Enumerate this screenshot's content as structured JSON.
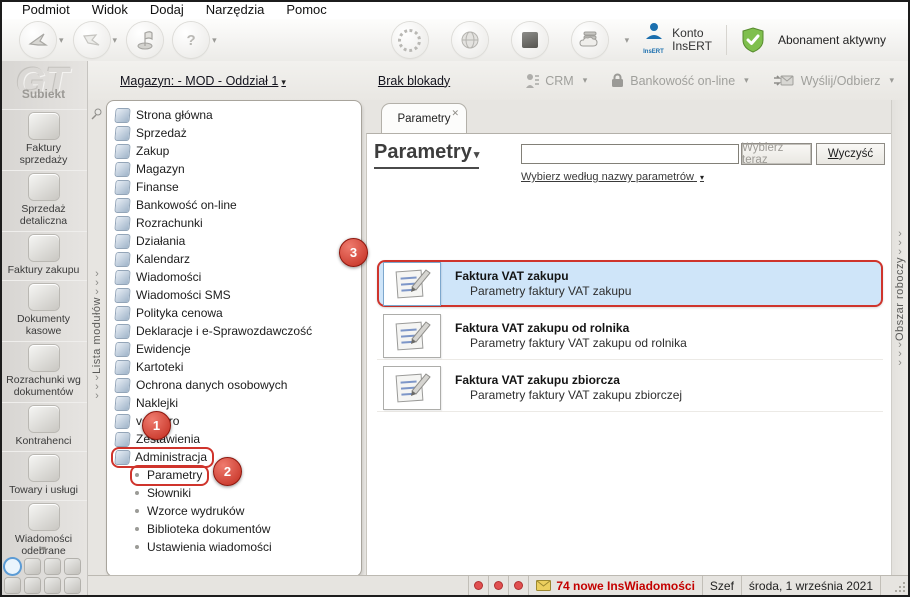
{
  "menu_bar": {
    "items": [
      "Podmiot",
      "Widok",
      "Dodaj",
      "Narzędzia",
      "Pomoc"
    ]
  },
  "toolbar": {
    "account_line1": "Konto",
    "account_line2": "InsERT",
    "account_badge": "InsERT",
    "subscription_label": "Abonament aktywny"
  },
  "context_bar": {
    "warehouse_label": "Magazyn: - MOD - Oddział 1",
    "lock_status": "Brak blokady",
    "crm_label": "CRM",
    "banking_label": "Bankowość on-line",
    "send_receive_label": "Wyślij/Odbierz"
  },
  "sidebar": {
    "logo_text": "GT",
    "app_name": "Subiekt",
    "items": [
      "Faktury sprzedaży",
      "Sprzedaż detaliczna",
      "Faktury zakupu",
      "Dokumenty kasowe",
      "Rozrachunki wg dokumentów",
      "Kontrahenci",
      "Towary i usługi",
      "Wiadomości odebrane"
    ]
  },
  "left_strip": {
    "label": "Lista modułów"
  },
  "right_strip": {
    "label": "Obszar roboczy"
  },
  "tree": {
    "items": [
      "Strona główna",
      "Sprzedaż",
      "Zakup",
      "Magazyn",
      "Finanse",
      "Bankowość on-line",
      "Rozrachunki",
      "Działania",
      "Kalendarz",
      "Wiadomości",
      "Wiadomości SMS",
      "Polityka cenowa",
      "Deklaracje i e-Sprawozdawczość",
      "Ewidencje",
      "Kartoteki",
      "Ochrona danych osobowych",
      "Naklejki",
      "vendero",
      "Zestawienia",
      "Administracja"
    ],
    "children": [
      "Parametry",
      "Słowniki",
      "Wzorce wydruków",
      "Biblioteka dokumentów",
      "Ustawienia wiadomości"
    ]
  },
  "main": {
    "tab_label": "Parametry",
    "heading": "Parametry",
    "search_value": "",
    "select_button": "Wybierz teraz",
    "clear_button": "Wyczyść",
    "filter_link": "Wybierz według nazwy parametrów",
    "list": [
      {
        "title": "Faktura VAT zakupu",
        "subtitle": "Parametry faktury VAT zakupu"
      },
      {
        "title": "Faktura VAT zakupu od rolnika",
        "subtitle": "Parametry faktury VAT zakupu od rolnika"
      },
      {
        "title": "Faktura VAT zakupu zbiorcza",
        "subtitle": "Parametry faktury VAT zakupu zbiorczej"
      }
    ]
  },
  "status_bar": {
    "messages_label": "74 nowe InsWiadomości",
    "user": "Szef",
    "date": "środa, 1 września 2021"
  },
  "annotations": {
    "step1": "1",
    "step2": "2",
    "step3": "3"
  },
  "icons": {
    "chevron_down": "▾",
    "chevron_right": "›",
    "close": "✕",
    "question": "?"
  },
  "colors": {
    "annotation_red": "#cf342c",
    "selection_blue": "#cfe5f9",
    "alert_red": "#c40000"
  }
}
